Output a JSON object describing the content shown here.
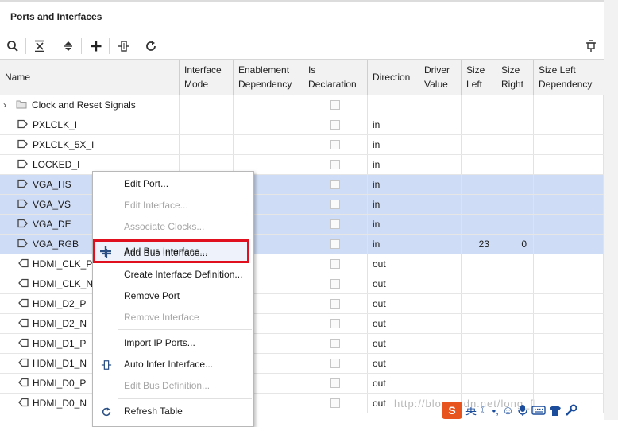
{
  "panel": {
    "title": "Ports and Interfaces"
  },
  "toolbar": {
    "icons": [
      "search-icon",
      "collapse-all-icon",
      "expand-all-icon",
      "add-icon",
      "bus-interface-icon",
      "refresh-icon"
    ],
    "right_icon": "pin-icon"
  },
  "columns": [
    {
      "key": "name",
      "label": "Name"
    },
    {
      "key": "mode",
      "label": "Interface Mode"
    },
    {
      "key": "enable",
      "label": "Enablement Dependency"
    },
    {
      "key": "decl",
      "label": "Is Declaration"
    },
    {
      "key": "dir",
      "label": "Direction"
    },
    {
      "key": "driver",
      "label": "Driver Value"
    },
    {
      "key": "sleft",
      "label": "Size Left"
    },
    {
      "key": "sright",
      "label": "Size Right"
    },
    {
      "key": "sldep",
      "label": "Size Left Dependency"
    }
  ],
  "rows": [
    {
      "name": "Clock and Reset Signals",
      "dir": "",
      "size_left": "",
      "size_right": "",
      "type": "folder",
      "selected": false
    },
    {
      "name": "PXLCLK_I",
      "dir": "in",
      "size_left": "",
      "size_right": "",
      "type": "in",
      "selected": false
    },
    {
      "name": "PXLCLK_5X_I",
      "dir": "in",
      "size_left": "",
      "size_right": "",
      "type": "in",
      "selected": false
    },
    {
      "name": "LOCKED_I",
      "dir": "in",
      "size_left": "",
      "size_right": "",
      "type": "in",
      "selected": false
    },
    {
      "name": "VGA_HS",
      "dir": "in",
      "size_left": "",
      "size_right": "",
      "type": "in",
      "selected": true
    },
    {
      "name": "VGA_VS",
      "dir": "in",
      "size_left": "",
      "size_right": "",
      "type": "in",
      "selected": true
    },
    {
      "name": "VGA_DE",
      "dir": "in",
      "size_left": "",
      "size_right": "",
      "type": "in",
      "selected": true
    },
    {
      "name": "VGA_RGB",
      "dir": "in",
      "size_left": "23",
      "size_right": "0",
      "type": "in",
      "selected": true
    },
    {
      "name": "HDMI_CLK_P",
      "dir": "out",
      "size_left": "",
      "size_right": "",
      "type": "out",
      "selected": false
    },
    {
      "name": "HDMI_CLK_N",
      "dir": "out",
      "size_left": "",
      "size_right": "",
      "type": "out",
      "selected": false
    },
    {
      "name": "HDMI_D2_P",
      "dir": "out",
      "size_left": "",
      "size_right": "",
      "type": "out",
      "selected": false
    },
    {
      "name": "HDMI_D2_N",
      "dir": "out",
      "size_left": "",
      "size_right": "",
      "type": "out",
      "selected": false
    },
    {
      "name": "HDMI_D1_P",
      "dir": "out",
      "size_left": "",
      "size_right": "",
      "type": "out",
      "selected": false
    },
    {
      "name": "HDMI_D1_N",
      "dir": "out",
      "size_left": "",
      "size_right": "",
      "type": "out",
      "selected": false
    },
    {
      "name": "HDMI_D0_P",
      "dir": "out",
      "size_left": "",
      "size_right": "",
      "type": "out",
      "selected": false
    },
    {
      "name": "HDMI_D0_N",
      "dir": "out",
      "size_left": "",
      "size_right": "",
      "type": "out",
      "selected": false
    }
  ],
  "context_menu": [
    {
      "label": "Edit Port...",
      "enabled": true,
      "icon": ""
    },
    {
      "label": "Edit Interface...",
      "enabled": false,
      "icon": ""
    },
    {
      "label": "Associate Clocks...",
      "enabled": false,
      "icon": ""
    },
    {
      "label": "Add Bus Interface...",
      "enabled": true,
      "icon": "plus-icon",
      "highlighted": true
    },
    {
      "label": "Create Interface Definition...",
      "enabled": true,
      "icon": ""
    },
    {
      "label": "Remove Port",
      "enabled": true,
      "icon": ""
    },
    {
      "label": "Remove Interface",
      "enabled": false,
      "icon": ""
    },
    {
      "label": "Import IP Ports...",
      "enabled": true,
      "icon": ""
    },
    {
      "label": "Auto Infer Interface...",
      "enabled": true,
      "icon": "bus-interface-icon"
    },
    {
      "label": "Edit Bus Definition...",
      "enabled": false,
      "icon": ""
    },
    {
      "label": "Refresh Table",
      "enabled": true,
      "icon": "refresh-icon"
    }
  ],
  "watermark": {
    "text": "http://blog.csdn.net/long_fl"
  },
  "ime": {
    "label": "英"
  },
  "colors": {
    "selection": "#cfdcf5",
    "highlight_border": "#e0101e",
    "accent_blue": "#2a6db5"
  }
}
